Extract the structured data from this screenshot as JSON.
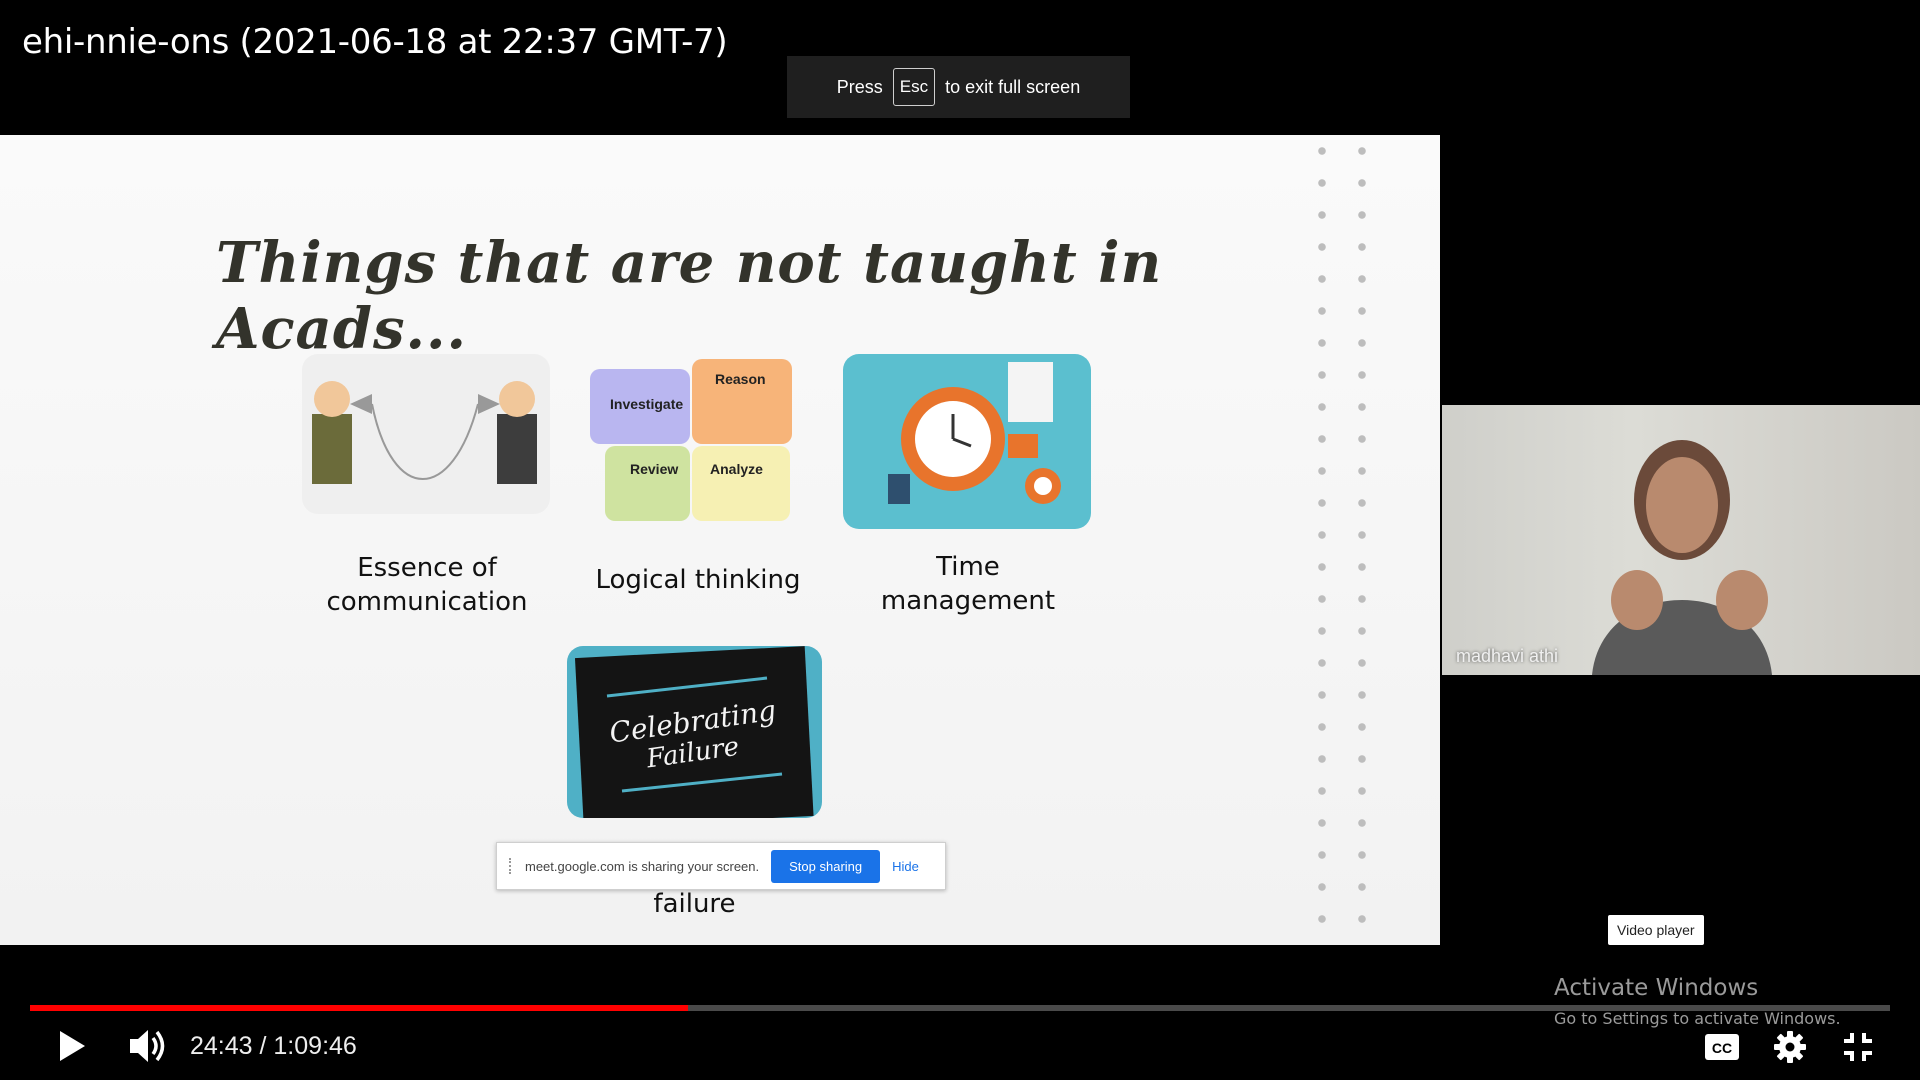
{
  "player": {
    "title": "ehi-nnie-ons (2021-06-18 at 22:37 GMT-7)",
    "fullscreen_notice": {
      "press": "Press",
      "key": "Esc",
      "rest": "to exit full screen"
    },
    "time_current": "24:43",
    "time_separator": " / ",
    "time_total": "1:09:46",
    "progress_fraction": 0.354,
    "tooltip": "Video player",
    "accent_color": "#ff0000"
  },
  "slide": {
    "title": "Things that are not taught in Acads...",
    "cards": [
      {
        "caption_1": "Essence of",
        "caption_2": "communication"
      },
      {
        "caption_1": "Logical thinking"
      },
      {
        "caption_1": "Time",
        "caption_2": "management"
      },
      {
        "caption_1": "failure"
      }
    ],
    "puzzle_labels": [
      "Investigate",
      "Reason",
      "Review",
      "Analyze"
    ],
    "failure_image_text_1": "Celebrating",
    "failure_image_text_2": "Failure"
  },
  "screen_share": {
    "message": "meet.google.com is sharing your screen.",
    "stop_label": "Stop sharing",
    "hide_label": "Hide"
  },
  "participant": {
    "name": "madhavi athi"
  },
  "windows_watermark": {
    "line1": "Activate Windows",
    "line2": "Go to Settings to activate Windows."
  },
  "icons": [
    "play-icon",
    "volume-icon",
    "captions-icon",
    "settings-gear-icon",
    "exit-fullscreen-icon"
  ]
}
